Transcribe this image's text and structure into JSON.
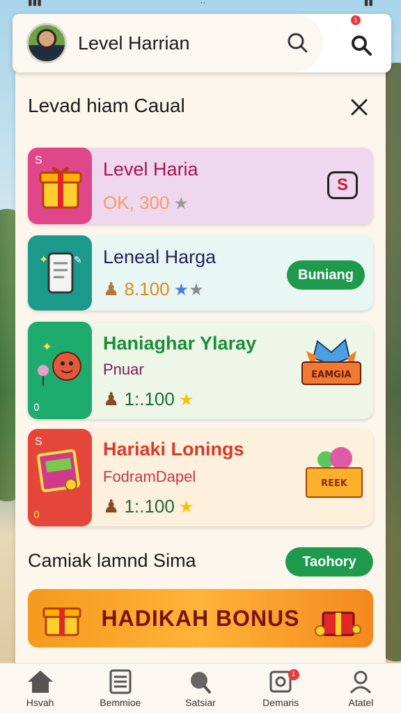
{
  "header": {
    "title": "Level Harrian",
    "notification_count": "1"
  },
  "section": {
    "title": "Levad hiam Caual"
  },
  "cards": [
    {
      "title": "Level Haria",
      "price": "OK, 300",
      "corner": "S",
      "badge": "S"
    },
    {
      "title": "Leneal Harga",
      "price": "8.100",
      "action": "Buniang"
    },
    {
      "title": "Haniaghar Ylaray",
      "subtitle": "Pnuar",
      "price": "1:.100",
      "corner_bottom": "0",
      "ribbon": "EAMGIA"
    },
    {
      "title": "Hariaki Lonings",
      "subtitle": "FodramDapel",
      "price": "1:.100",
      "corner": "S",
      "corner_bottom": "0",
      "box_label": "REEK"
    }
  ],
  "bottom": {
    "title": "Camiak lamnd Sima",
    "action": "Taohory",
    "banner": "HADIKAH BONUS"
  },
  "nav": {
    "items": [
      {
        "label": "Hsvah",
        "icon": "home-icon"
      },
      {
        "label": "Bemmioe",
        "icon": "list-icon"
      },
      {
        "label": "Satsiar",
        "icon": "search-icon"
      },
      {
        "label": "Demaris",
        "icon": "inbox-icon"
      },
      {
        "label": "Atatel",
        "icon": "profile-icon"
      }
    ],
    "demaris_badge": "1"
  },
  "colors": {
    "accent_green": "#1e9a4d",
    "title_pink": "#a2154a",
    "title_navy": "#23245a",
    "title_green": "#1a8f3a",
    "title_red": "#d83b2a"
  }
}
